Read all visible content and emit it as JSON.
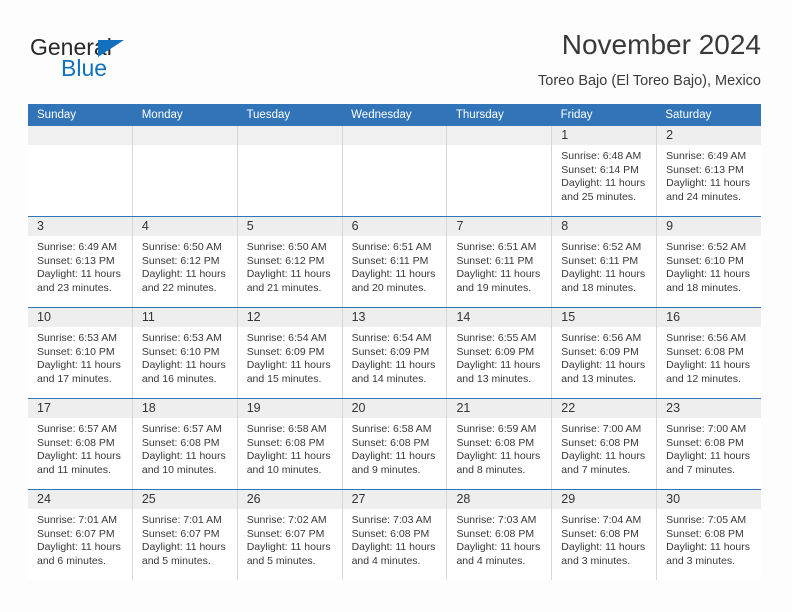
{
  "brand": {
    "name_top": "General",
    "name_bottom": "Blue",
    "triangle_color": "#1271bf",
    "text_color": "#28282a"
  },
  "header": {
    "title": "November 2024",
    "subtitle": "Toreo Bajo (El Toreo Bajo), Mexico"
  },
  "theme": {
    "header_blue": "#3174b8",
    "day_band_gray": "#eeeeee",
    "cell_border": "#d6d6d6",
    "text": "#38383a"
  },
  "weekdays": [
    "Sunday",
    "Monday",
    "Tuesday",
    "Wednesday",
    "Thursday",
    "Friday",
    "Saturday"
  ],
  "weeks": [
    [
      {
        "day": "",
        "empty": true
      },
      {
        "day": "",
        "empty": true
      },
      {
        "day": "",
        "empty": true
      },
      {
        "day": "",
        "empty": true
      },
      {
        "day": "",
        "empty": true
      },
      {
        "day": "1",
        "sunrise": "Sunrise: 6:48 AM",
        "sunset": "Sunset: 6:14 PM",
        "daylight": "Daylight: 11 hours and 25 minutes."
      },
      {
        "day": "2",
        "sunrise": "Sunrise: 6:49 AM",
        "sunset": "Sunset: 6:13 PM",
        "daylight": "Daylight: 11 hours and 24 minutes."
      }
    ],
    [
      {
        "day": "3",
        "sunrise": "Sunrise: 6:49 AM",
        "sunset": "Sunset: 6:13 PM",
        "daylight": "Daylight: 11 hours and 23 minutes."
      },
      {
        "day": "4",
        "sunrise": "Sunrise: 6:50 AM",
        "sunset": "Sunset: 6:12 PM",
        "daylight": "Daylight: 11 hours and 22 minutes."
      },
      {
        "day": "5",
        "sunrise": "Sunrise: 6:50 AM",
        "sunset": "Sunset: 6:12 PM",
        "daylight": "Daylight: 11 hours and 21 minutes."
      },
      {
        "day": "6",
        "sunrise": "Sunrise: 6:51 AM",
        "sunset": "Sunset: 6:11 PM",
        "daylight": "Daylight: 11 hours and 20 minutes."
      },
      {
        "day": "7",
        "sunrise": "Sunrise: 6:51 AM",
        "sunset": "Sunset: 6:11 PM",
        "daylight": "Daylight: 11 hours and 19 minutes."
      },
      {
        "day": "8",
        "sunrise": "Sunrise: 6:52 AM",
        "sunset": "Sunset: 6:11 PM",
        "daylight": "Daylight: 11 hours and 18 minutes."
      },
      {
        "day": "9",
        "sunrise": "Sunrise: 6:52 AM",
        "sunset": "Sunset: 6:10 PM",
        "daylight": "Daylight: 11 hours and 18 minutes."
      }
    ],
    [
      {
        "day": "10",
        "sunrise": "Sunrise: 6:53 AM",
        "sunset": "Sunset: 6:10 PM",
        "daylight": "Daylight: 11 hours and 17 minutes."
      },
      {
        "day": "11",
        "sunrise": "Sunrise: 6:53 AM",
        "sunset": "Sunset: 6:10 PM",
        "daylight": "Daylight: 11 hours and 16 minutes."
      },
      {
        "day": "12",
        "sunrise": "Sunrise: 6:54 AM",
        "sunset": "Sunset: 6:09 PM",
        "daylight": "Daylight: 11 hours and 15 minutes."
      },
      {
        "day": "13",
        "sunrise": "Sunrise: 6:54 AM",
        "sunset": "Sunset: 6:09 PM",
        "daylight": "Daylight: 11 hours and 14 minutes."
      },
      {
        "day": "14",
        "sunrise": "Sunrise: 6:55 AM",
        "sunset": "Sunset: 6:09 PM",
        "daylight": "Daylight: 11 hours and 13 minutes."
      },
      {
        "day": "15",
        "sunrise": "Sunrise: 6:56 AM",
        "sunset": "Sunset: 6:09 PM",
        "daylight": "Daylight: 11 hours and 13 minutes."
      },
      {
        "day": "16",
        "sunrise": "Sunrise: 6:56 AM",
        "sunset": "Sunset: 6:08 PM",
        "daylight": "Daylight: 11 hours and 12 minutes."
      }
    ],
    [
      {
        "day": "17",
        "sunrise": "Sunrise: 6:57 AM",
        "sunset": "Sunset: 6:08 PM",
        "daylight": "Daylight: 11 hours and 11 minutes."
      },
      {
        "day": "18",
        "sunrise": "Sunrise: 6:57 AM",
        "sunset": "Sunset: 6:08 PM",
        "daylight": "Daylight: 11 hours and 10 minutes."
      },
      {
        "day": "19",
        "sunrise": "Sunrise: 6:58 AM",
        "sunset": "Sunset: 6:08 PM",
        "daylight": "Daylight: 11 hours and 10 minutes."
      },
      {
        "day": "20",
        "sunrise": "Sunrise: 6:58 AM",
        "sunset": "Sunset: 6:08 PM",
        "daylight": "Daylight: 11 hours and 9 minutes."
      },
      {
        "day": "21",
        "sunrise": "Sunrise: 6:59 AM",
        "sunset": "Sunset: 6:08 PM",
        "daylight": "Daylight: 11 hours and 8 minutes."
      },
      {
        "day": "22",
        "sunrise": "Sunrise: 7:00 AM",
        "sunset": "Sunset: 6:08 PM",
        "daylight": "Daylight: 11 hours and 7 minutes."
      },
      {
        "day": "23",
        "sunrise": "Sunrise: 7:00 AM",
        "sunset": "Sunset: 6:08 PM",
        "daylight": "Daylight: 11 hours and 7 minutes."
      }
    ],
    [
      {
        "day": "24",
        "sunrise": "Sunrise: 7:01 AM",
        "sunset": "Sunset: 6:07 PM",
        "daylight": "Daylight: 11 hours and 6 minutes."
      },
      {
        "day": "25",
        "sunrise": "Sunrise: 7:01 AM",
        "sunset": "Sunset: 6:07 PM",
        "daylight": "Daylight: 11 hours and 5 minutes."
      },
      {
        "day": "26",
        "sunrise": "Sunrise: 7:02 AM",
        "sunset": "Sunset: 6:07 PM",
        "daylight": "Daylight: 11 hours and 5 minutes."
      },
      {
        "day": "27",
        "sunrise": "Sunrise: 7:03 AM",
        "sunset": "Sunset: 6:08 PM",
        "daylight": "Daylight: 11 hours and 4 minutes."
      },
      {
        "day": "28",
        "sunrise": "Sunrise: 7:03 AM",
        "sunset": "Sunset: 6:08 PM",
        "daylight": "Daylight: 11 hours and 4 minutes."
      },
      {
        "day": "29",
        "sunrise": "Sunrise: 7:04 AM",
        "sunset": "Sunset: 6:08 PM",
        "daylight": "Daylight: 11 hours and 3 minutes."
      },
      {
        "day": "30",
        "sunrise": "Sunrise: 7:05 AM",
        "sunset": "Sunset: 6:08 PM",
        "daylight": "Daylight: 11 hours and 3 minutes."
      }
    ]
  ]
}
